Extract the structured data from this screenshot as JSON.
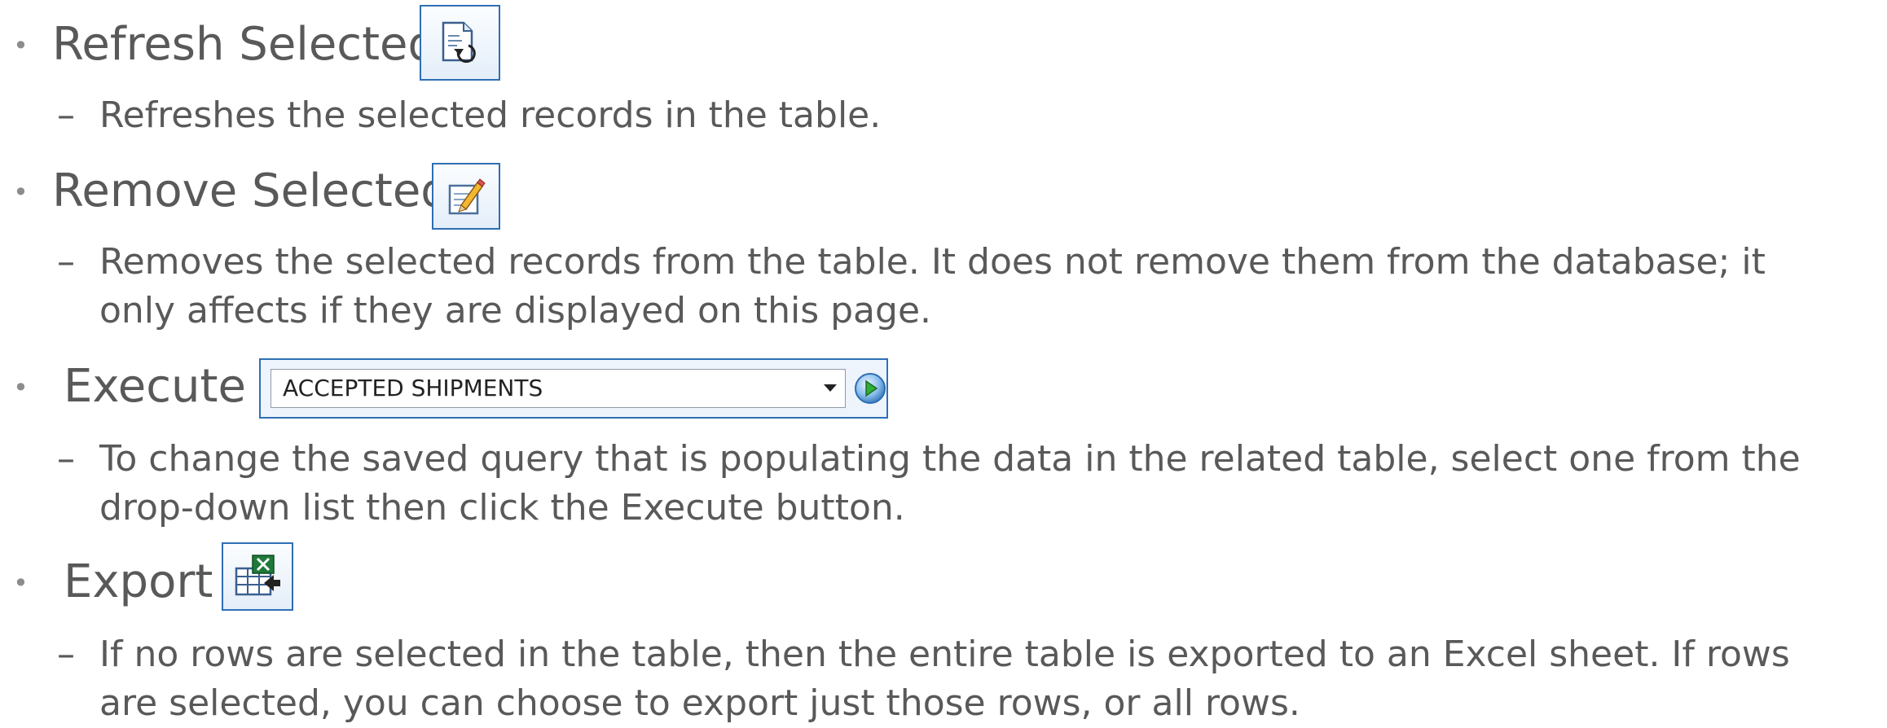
{
  "items": [
    {
      "title": "Refresh Selected",
      "icon": "refresh-selected-icon",
      "description": "Refreshes the selected records in the table."
    },
    {
      "title": "Remove Selected",
      "icon": "remove-selected-icon",
      "description": "Removes the selected records from the table. It does not remove them from the database; it only affects if they are displayed on this page."
    },
    {
      "title": "Execute",
      "query_select": {
        "selected": "ACCEPTED SHIPMENTS"
      },
      "icon": "execute-go-icon",
      "description": "To change the saved query that is populating the data in the related table, select one from the drop-down list then click the Execute button."
    },
    {
      "title": "Export",
      "icon": "export-excel-icon",
      "description": "If no rows are selected in the table, then the entire table is exported to an Excel sheet. If rows are selected, you can choose to export just those rows, or all rows."
    }
  ],
  "colors": {
    "text": "#595959",
    "bullet": "#8c8c8c",
    "button_border": "#2e6fb4"
  }
}
